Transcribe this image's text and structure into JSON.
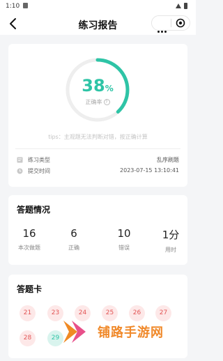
{
  "statusbar": {
    "time": "1:10"
  },
  "navbar": {
    "title": "练习报告"
  },
  "summary": {
    "accuracy": 38,
    "accuracy_suffix": "%",
    "accuracy_label": "正确率",
    "help_glyph": "?",
    "tips": "tips：主观题无法判断对错，按正确计算",
    "type_label": "练习类型",
    "type_value": "乱序刷题",
    "time_label": "提交时间",
    "time_value": "2023-07-15 13:10:41"
  },
  "stats": {
    "title": "答题情况",
    "items": [
      {
        "value": "16",
        "label": "本次做题"
      },
      {
        "value": "6",
        "label": "正确"
      },
      {
        "value": "10",
        "label": "错误"
      },
      {
        "value": "1分",
        "label": "用时"
      }
    ]
  },
  "answer_card": {
    "title": "答题卡",
    "items": [
      {
        "num": "21",
        "status": "wrong"
      },
      {
        "num": "23",
        "status": "wrong"
      },
      {
        "num": "24",
        "status": "wrong"
      },
      {
        "num": "25",
        "status": "wrong"
      },
      {
        "num": "26",
        "status": "wrong"
      },
      {
        "num": "27",
        "status": "wrong"
      },
      {
        "num": "28",
        "status": "wrong"
      },
      {
        "num": "29",
        "status": "correct"
      }
    ]
  },
  "watermark": {
    "text": "铺路手游网"
  },
  "colors": {
    "accent": "#2ec4a6",
    "wrong": "#e25555",
    "watermark": "#f0892a"
  }
}
